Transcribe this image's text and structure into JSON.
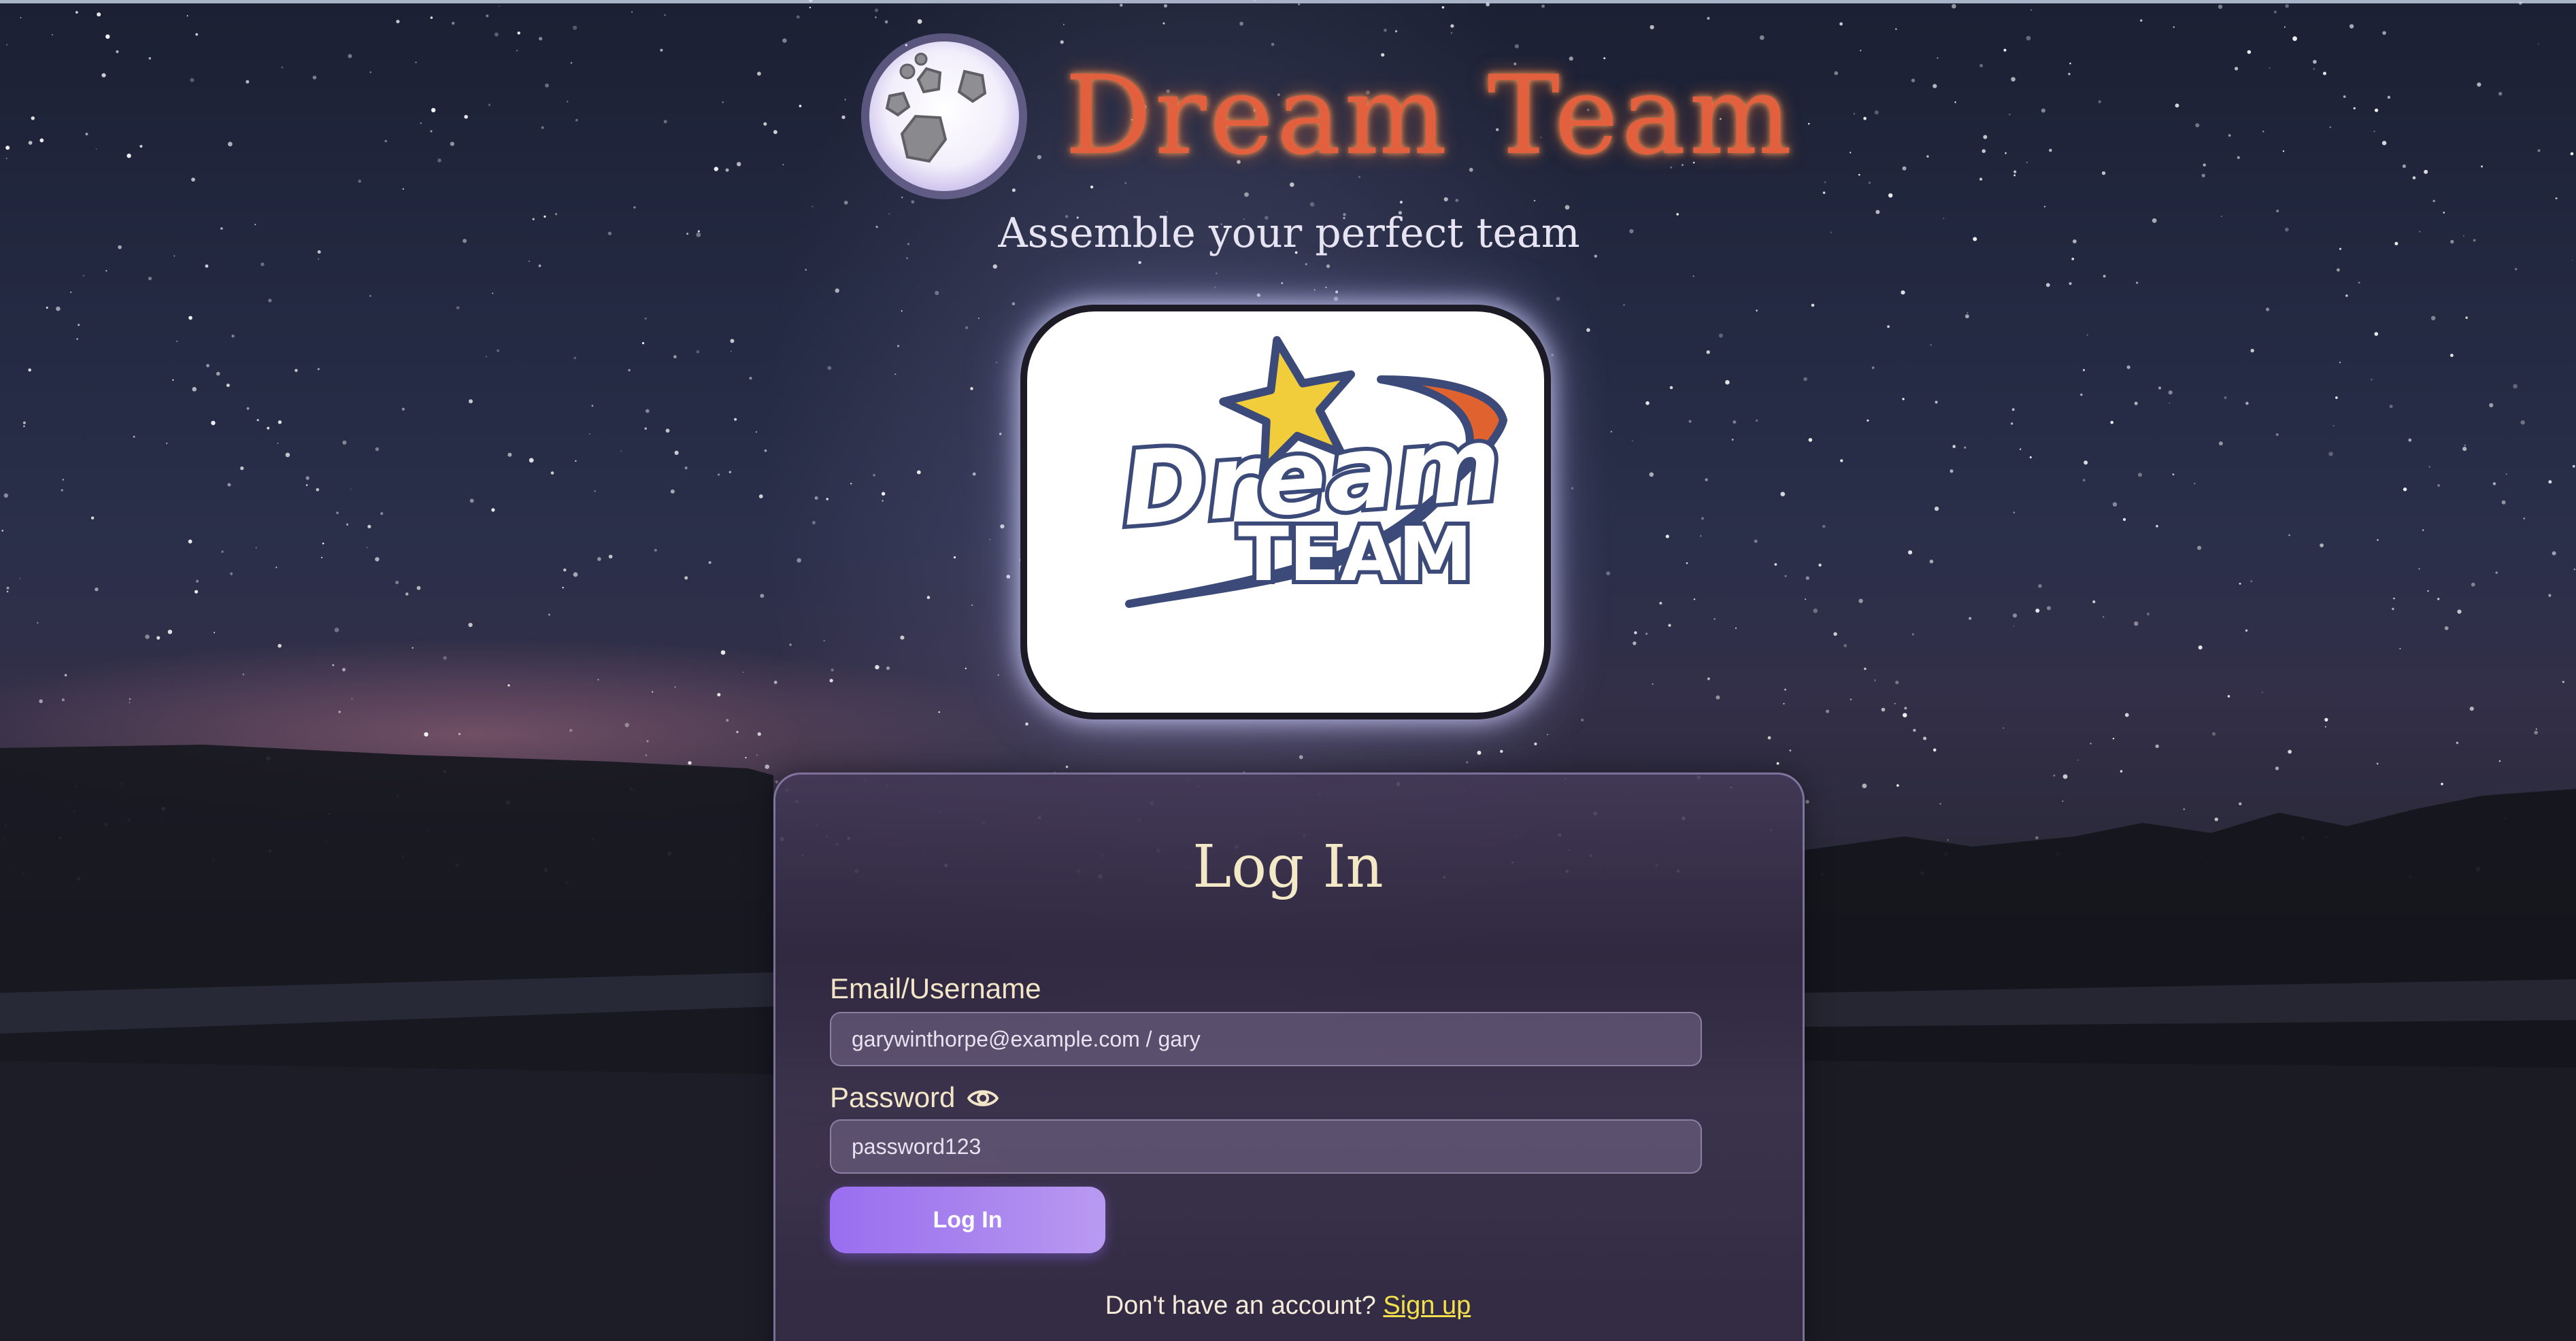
{
  "header": {
    "title": "Dream Team",
    "tagline": "Assemble your perfect team",
    "moon_icon": "moon-icon"
  },
  "logo": {
    "line1": "Dream",
    "line2": "TEAM",
    "star_icon": "star-icon"
  },
  "login": {
    "heading": "Log In",
    "email_label": "Email/Username",
    "email_placeholder": "garywinthorpe@example.com / gary",
    "password_label": "Password",
    "password_toggle_icon": "eye-icon",
    "password_placeholder": "password123",
    "submit_label": "Log In",
    "signup_prompt": "Don't have an account?",
    "signup_link": "Sign up"
  },
  "colors": {
    "title": "#e2603e",
    "heading": "#f4e9c6",
    "button": "#a985ee",
    "link": "#f3e04a",
    "logo_orange": "#e0622f",
    "logo_navy": "#3b4a78",
    "logo_star": "#f1cd3c"
  }
}
